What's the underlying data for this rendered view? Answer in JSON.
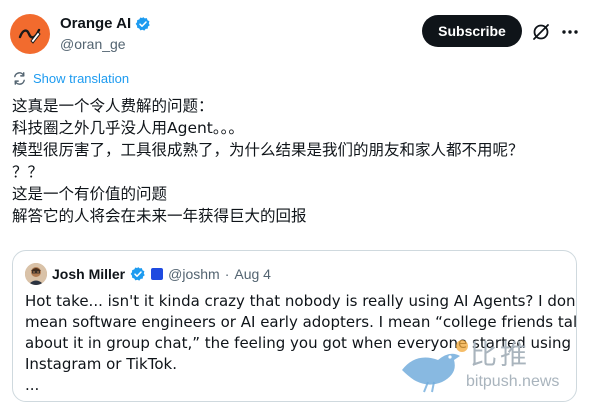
{
  "author": {
    "display_name": "Orange AI",
    "handle": "@oran_ge"
  },
  "actions": {
    "subscribe_label": "Subscribe"
  },
  "translation_label": "Show translation",
  "tweet_lines": [
    "这真是一个令人费解的问题：",
    "科技圈之外几乎没人用Agent。。。",
    "模型很厉害了，工具很成熟了，为什么结果是我们的朋友和家人都不用呢？",
    "？？",
    "这是一个有价值的问题",
    "解答它的人将会在未来一年获得巨大的回报"
  ],
  "quoted_tweet": {
    "display_name": "Josh Miller",
    "handle": "@joshm",
    "separator": "·",
    "date": "Aug 4",
    "lines": [
      "Hot take... isn't it kinda crazy that nobody is really using AI Agents? I don't",
      "mean software engineers or AI early adopters. I mean “college friends talking",
      "about it in group chat,” the feeling you got when everyone started using",
      "Instagram or TikTok.",
      "..."
    ]
  },
  "watermark": {
    "chinese": "比推",
    "domain": "bitpush.news"
  },
  "colors": {
    "accent": "#1d9bf0",
    "avatar_bg": "#f26b2e",
    "button_bg": "#0f1419",
    "muted_text": "#536471",
    "border": "#cfd9de"
  },
  "icons": [
    "pen-icon",
    "verified-badge-icon",
    "grok-icon",
    "more-options-icon",
    "translate-icon",
    "bird-watermark-icon"
  ]
}
